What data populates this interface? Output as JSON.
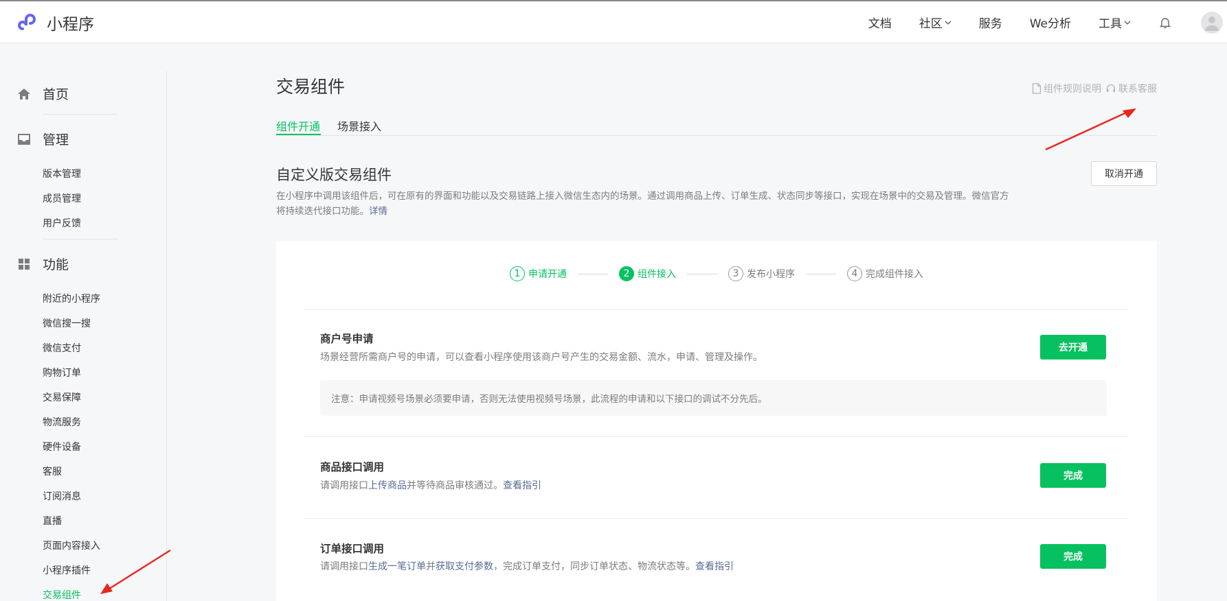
{
  "header": {
    "app_name": "小程序",
    "nav": [
      {
        "label": "文档",
        "dropdown": false
      },
      {
        "label": "社区",
        "dropdown": true
      },
      {
        "label": "服务",
        "dropdown": false
      },
      {
        "label": "We分析",
        "dropdown": false
      },
      {
        "label": "工具",
        "dropdown": true
      }
    ]
  },
  "sidebar": {
    "home_label": "首页",
    "manage_label": "管理",
    "manage_items": [
      "版本管理",
      "成员管理",
      "用户反馈"
    ],
    "features_label": "功能",
    "feature_items": [
      "附近的小程序",
      "微信搜一搜",
      "微信支付",
      "购物订单",
      "交易保障",
      "物流服务",
      "硬件设备",
      "客服",
      "订阅消息",
      "直播",
      "页面内容接入",
      "小程序插件",
      "交易组件"
    ],
    "active_item": "交易组件"
  },
  "main": {
    "title": "交易组件",
    "links": {
      "rules": "组件规则说明",
      "support": "联系客服"
    },
    "tabs": [
      {
        "label": "组件开通"
      },
      {
        "label": "场景接入"
      }
    ],
    "active_tab": "组件开通",
    "section_title": "自定义版交易组件",
    "cancel_button": "取消开通",
    "section_desc": "在小程序中调用该组件后，可在原有的界面和功能以及交易链路上接入微信生态内的场景。通过调用商品上传、订单生成、状态同步等接口，实现在场景中的交易及管理。微信官方将持续迭代接口功能。",
    "section_desc_link": "详情",
    "steps": [
      {
        "num": "1",
        "label": "申请开通",
        "state": "done"
      },
      {
        "num": "2",
        "label": "组件接入",
        "state": "current"
      },
      {
        "num": "3",
        "label": "发布小程序",
        "state": "todo"
      },
      {
        "num": "4",
        "label": "完成组件接入",
        "state": "todo"
      }
    ],
    "items": {
      "merchant": {
        "title": "商户号申请",
        "desc": "场景经营所需商户号的申请，可以查看小程序使用该商户号产生的交易金额、流水，申请、管理及操作。",
        "notice": "注意：申请视频号场景必须要申请，否则无法使用视频号场景，此流程的申请和以下接口的调试不分先后。",
        "button": "去开通"
      },
      "product": {
        "title": "商品接口调用",
        "desc_pre": "请调用接口",
        "desc_link1": "上传商品",
        "desc_mid": "并等待商品审核通过。",
        "desc_link2": "查看指引",
        "button": "完成"
      },
      "order": {
        "title": "订单接口调用",
        "desc_pre": "请调用接口",
        "desc_link1": "生成一笔订单",
        "desc_mid1": "并",
        "desc_link2": "获取支付参数",
        "desc_mid2": "，完成订单支付，同步订单状态、物流状态等。",
        "desc_link3": "查看指引",
        "button": "完成"
      }
    }
  },
  "colors": {
    "accent": "#07c160",
    "link": "#576b95",
    "annotation_arrow": "#e8271c"
  }
}
